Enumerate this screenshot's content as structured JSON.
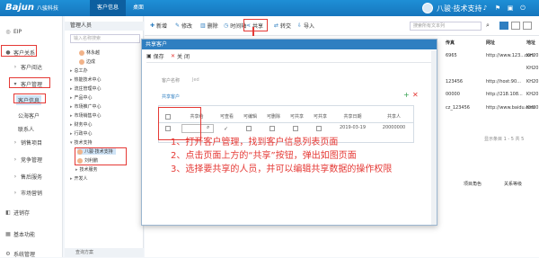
{
  "topbar": {
    "brand": "Bajun",
    "brand_sub": "八骏科技",
    "tabs": [
      "客户信息",
      "桌面"
    ],
    "user_name": "八骏·技术支持"
  },
  "sidebar": {
    "items": [
      "EIP",
      "客户关系",
      "客户阅达",
      "客户管理",
      "客户信息",
      "公海客户",
      "联系人",
      "销售项目",
      "竞争管理",
      "售后服务",
      "市场营销",
      "进销存",
      "基本功能",
      "系统管理"
    ]
  },
  "tree": {
    "header": "管理人员",
    "search_placeholder": "输入名称搜索",
    "nodes": [
      "林永越",
      "边成",
      "总工办",
      "热能技术中心",
      "流庄管理中心",
      "产品中心",
      "市场推广中心",
      "市场销售中心",
      "财务中心",
      "行政中心",
      "技术支持",
      "八骏·技术支持",
      "刘利鹏",
      "技术服务",
      "开发人"
    ],
    "bottom_label": "查询方案"
  },
  "toolbar": {
    "buttons": [
      "新增",
      "修改",
      "删除",
      "时间轴",
      "共享",
      "转交",
      "导入"
    ],
    "search_placeholder": "搜索所有文本列"
  },
  "right_table": {
    "headers": [
      "传真",
      "网址",
      "地址"
    ],
    "rows": [
      [
        "6965",
        "http://www.123...com",
        "KH20"
      ],
      [
        "",
        "",
        "KH20"
      ],
      [
        "123456",
        "http://host:90...",
        "KH20"
      ],
      [
        "00000",
        "http://218.108...",
        "KH20"
      ],
      [
        "cz_123456",
        "http://www.baidu.com",
        "KH20"
      ]
    ],
    "pager": "显示条目 1 - 5 共 5",
    "sub_headers": [
      "项目角色",
      "关系等级"
    ]
  },
  "dialog": {
    "title": "共享客户",
    "save_label": "保存",
    "close_label": "关 闭",
    "customer_name_label": "客户名称",
    "customer_name_value": "Jed",
    "section_label": "共享客户",
    "columns": [
      "共享给",
      "可查看",
      "可编辑",
      "可删除",
      "可共享",
      "可共享",
      "共享日期",
      "共享人"
    ],
    "row": {
      "date": "2019-03-19",
      "sharer": "20000000"
    }
  },
  "annotation": {
    "lines": [
      "1、打开客户管理，找到客户信息列表页面",
      "2、点击页面上方的“共享”按钮，弹出如图页面",
      "3、选择要共享的人员，并可以编辑共享数据的操作权限"
    ]
  },
  "colors": {
    "brand_blue": "#1676bd",
    "highlight_red": "#e53935"
  }
}
